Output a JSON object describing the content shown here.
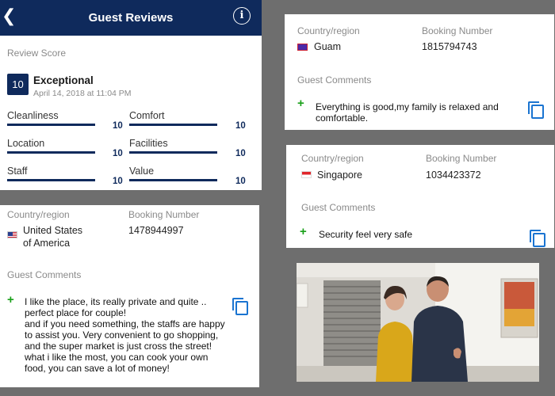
{
  "header": {
    "title": "Guest Reviews",
    "back_icon": "chevron-left-icon",
    "info_icon": "info-icon"
  },
  "score": {
    "section_label": "Review Score",
    "value": "10",
    "rating_text": "Exceptional",
    "date": "April 14, 2018 at 11:04 PM",
    "categories": [
      {
        "label": "Cleanliness",
        "value": "10",
        "fraction": 1.0
      },
      {
        "label": "Comfort",
        "value": "10",
        "fraction": 1.0
      },
      {
        "label": "Location",
        "value": "10",
        "fraction": 1.0
      },
      {
        "label": "Facilities",
        "value": "10",
        "fraction": 1.0
      },
      {
        "label": "Staff",
        "value": "10",
        "fraction": 1.0
      },
      {
        "label": "Value",
        "value": "10",
        "fraction": 1.0
      }
    ]
  },
  "review_us": {
    "country_label": "Country/region",
    "country_line1": "United States",
    "country_line2": "of America",
    "booking_label": "Booking Number",
    "booking_number": "1478944997",
    "comments_label": "Guest Comments",
    "comment_lines": [
      "I like the place, its really private and quite ..",
      "perfect place for couple!",
      "and if you need something, the staffs are happy",
      "to assist you. Very convenient to go shopping,",
      "and the super market is just cross the street!",
      "what i like the most, you can cook your own",
      "food, you can save a lot of money!"
    ]
  },
  "review_guam": {
    "country_label": "Country/region",
    "country": "Guam",
    "booking_label": "Booking Number",
    "booking_number": "1815794743",
    "comments_label": "Guest Comments",
    "comment_lines": [
      "Everything is good,my family is relaxed and",
      "comfortable."
    ]
  },
  "review_sg": {
    "country_label": "Country/region",
    "country": "Singapore",
    "booking_label": "Booking Number",
    "booking_number": "1034423372",
    "comments_label": "Guest Comments",
    "comment_lines": [
      "Security feel very safe"
    ]
  },
  "colors": {
    "navy": "#0f2a5c",
    "plus_green": "#19a019",
    "copy_blue": "#1a74d1"
  }
}
